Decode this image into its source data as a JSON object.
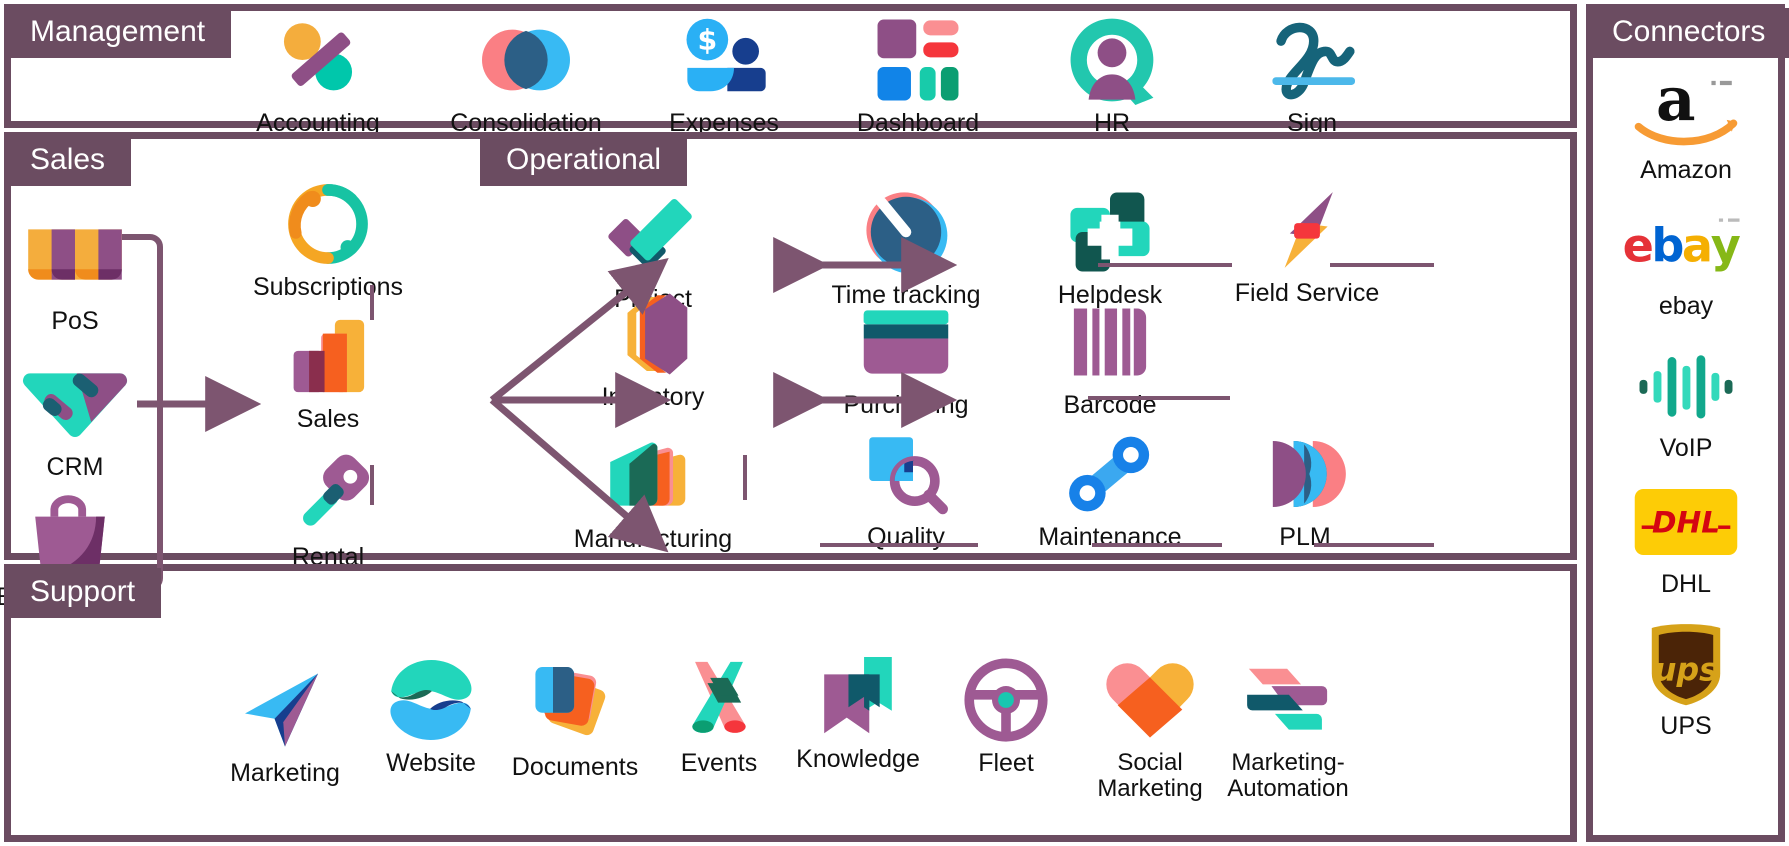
{
  "theme": {
    "frame_color": "#6b4c61",
    "label_text_color": "#ffffff",
    "background": "#ffffff",
    "arrow_color": "#7d5570"
  },
  "sections": {
    "management": {
      "label": "Management"
    },
    "sales": {
      "label": "Sales"
    },
    "operational": {
      "label": "Operational"
    },
    "support": {
      "label": "Support"
    },
    "connectors": {
      "label": "Connectors"
    }
  },
  "management_apps": [
    {
      "label": "Accounting",
      "icon": "accounting-icon"
    },
    {
      "label": "Consolidation",
      "icon": "consolidation-icon"
    },
    {
      "label": "Expenses",
      "icon": "expenses-icon"
    },
    {
      "label": "Dashboard",
      "icon": "dashboard-icon"
    },
    {
      "label": "HR",
      "icon": "hr-icon"
    },
    {
      "label": "Sign",
      "icon": "sign-icon"
    }
  ],
  "sales_apps": [
    {
      "label": "PoS",
      "icon": "pos-icon"
    },
    {
      "label": "CRM",
      "icon": "crm-icon"
    },
    {
      "label": "E-Commerce",
      "icon": "ecommerce-icon"
    }
  ],
  "core_apps": [
    {
      "label": "Subscriptions",
      "icon": "subscriptions-icon"
    },
    {
      "label": "Sales",
      "icon": "sales-icon"
    },
    {
      "label": "Rental",
      "icon": "rental-icon"
    }
  ],
  "operational_apps": {
    "row1": [
      {
        "label": "Project",
        "icon": "project-icon"
      },
      {
        "label": "Time tracking",
        "icon": "time-tracking-icon"
      },
      {
        "label": "Helpdesk",
        "icon": "helpdesk-icon"
      },
      {
        "label": "Field Service",
        "icon": "field-service-icon"
      }
    ],
    "row2": [
      {
        "label": "Inventory",
        "icon": "inventory-icon"
      },
      {
        "label": "Purchasing",
        "icon": "purchasing-icon"
      },
      {
        "label": "Barcode",
        "icon": "barcode-icon"
      }
    ],
    "row3": [
      {
        "label": "Manufacturing",
        "icon": "manufacturing-icon"
      },
      {
        "label": "Quality",
        "icon": "quality-icon"
      },
      {
        "label": "Maintenance",
        "icon": "maintenance-icon"
      },
      {
        "label": "PLM",
        "icon": "plm-icon"
      }
    ]
  },
  "support_apps": [
    {
      "label": "Marketing",
      "icon": "marketing-icon"
    },
    {
      "label": "Website",
      "icon": "website-icon"
    },
    {
      "label": "Documents",
      "icon": "documents-icon"
    },
    {
      "label": "Events",
      "icon": "events-icon"
    },
    {
      "label": "Knowledge",
      "icon": "knowledge-icon"
    },
    {
      "label": "Fleet",
      "icon": "fleet-icon"
    },
    {
      "label": "Social\nMarketing",
      "icon": "social-marketing-icon"
    },
    {
      "label": "Marketing-\nAutomation",
      "icon": "marketing-automation-icon"
    }
  ],
  "connector_apps": [
    {
      "label": "Amazon",
      "icon": "amazon-logo"
    },
    {
      "label": "ebay",
      "icon": "ebay-logo"
    },
    {
      "label": "VoIP",
      "icon": "voip-icon"
    },
    {
      "label": "DHL",
      "icon": "dhl-logo"
    },
    {
      "label": "UPS",
      "icon": "ups-logo"
    }
  ]
}
